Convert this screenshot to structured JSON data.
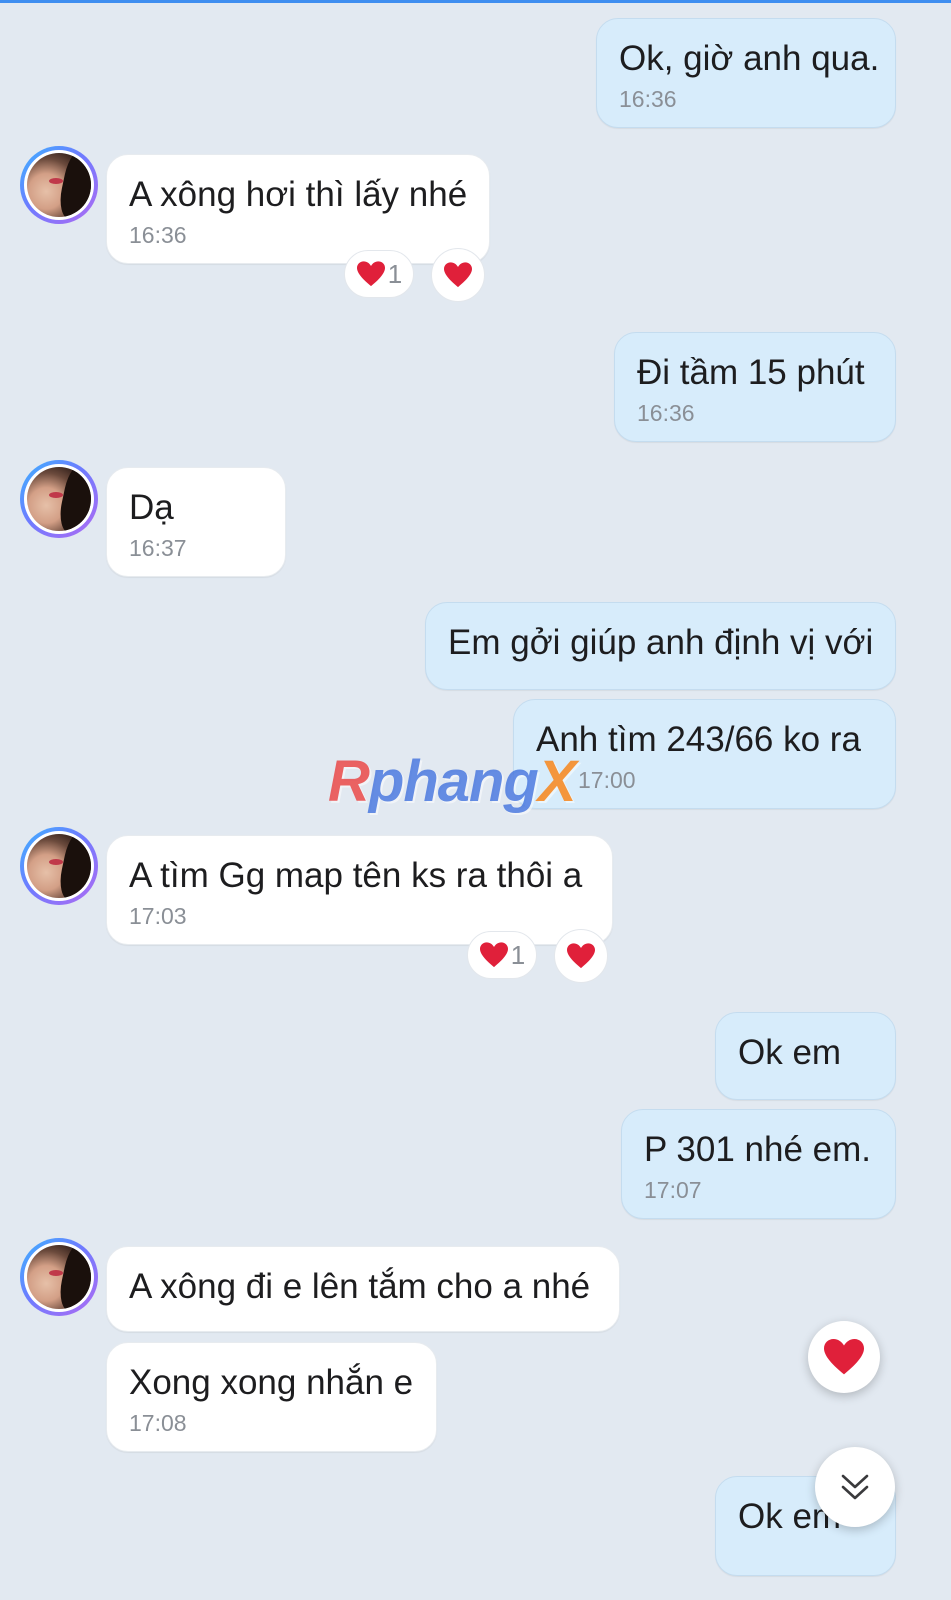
{
  "conversation": {
    "messages": [
      {
        "text": "Ok, giờ anh qua.",
        "time": "16:36"
      },
      {
        "text": "A xông hơi thì lấy nhé",
        "time": "16:36",
        "reaction_count": "1"
      },
      {
        "text": "Đi tầm 15 phút",
        "time": "16:36"
      },
      {
        "text": "Dạ",
        "time": "16:37"
      },
      {
        "text": "Em gởi giúp anh định vị với"
      },
      {
        "text": "Anh tìm 243/66 ko ra",
        "time": "17:00"
      },
      {
        "text": "A tìm Gg map tên ks ra thôi a",
        "time": "17:03",
        "reaction_count": "1"
      },
      {
        "text": "Ok em"
      },
      {
        "text": "P 301 nhé em.",
        "time": "17:07"
      },
      {
        "text": "A xông đi e lên tắm cho a nhé"
      },
      {
        "text": "Xong xong nhắn e",
        "time": "17:08"
      },
      {
        "text": "Ok em"
      }
    ]
  },
  "watermark": {
    "part1": "R",
    "part2": "phang",
    "part3": "X"
  },
  "colors": {
    "background": "#e2e9f1",
    "outgoing_bubble": "#d7ecfb",
    "incoming_bubble": "#ffffff",
    "heart": "#e0203a",
    "timestamp": "#8a8f96"
  },
  "icons": {
    "heart": "heart-icon",
    "scroll_down": "double-chevron-down-icon",
    "avatar": "contact-avatar"
  }
}
